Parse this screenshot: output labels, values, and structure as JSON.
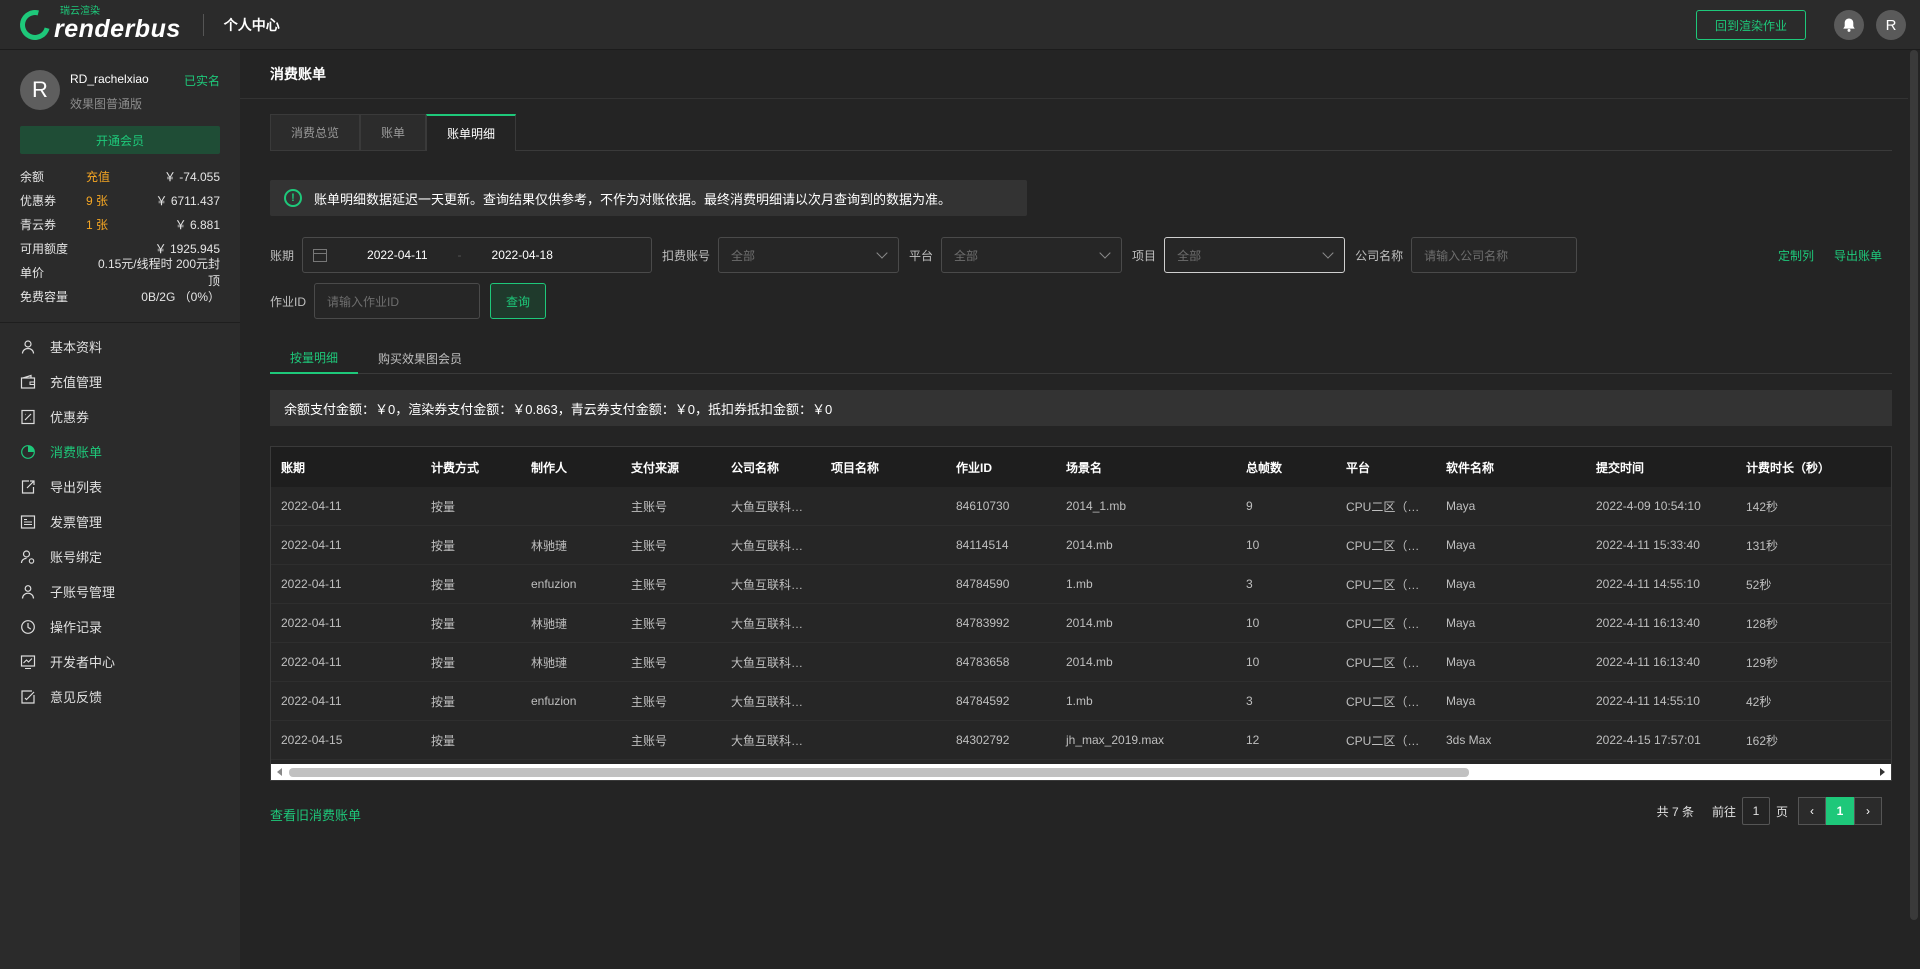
{
  "header": {
    "logo_sub": "瑞云渲染",
    "logo_main": "renderbus",
    "title": "个人中心",
    "back_button": "回到渲染作业",
    "avatar_letter": "R"
  },
  "user": {
    "avatar_letter": "R",
    "name": "RD_rachelxiao",
    "plan": "效果图普通版",
    "verified": "已实名",
    "vip_button": "开通会员",
    "info": [
      {
        "label": "余额",
        "mid": "充值",
        "value": "￥ -74.055"
      },
      {
        "label": "优惠券",
        "mid": "9 张",
        "value": "￥ 6711.437"
      },
      {
        "label": "青云券",
        "mid": "1 张",
        "value": "￥ 6.881"
      },
      {
        "label": "可用额度",
        "mid": "",
        "value": "￥ 1925.945"
      },
      {
        "label": "单价",
        "mid": "",
        "value": "0.15元/线程时 200元封顶"
      },
      {
        "label": "免费容量",
        "mid": "",
        "value": "0B/2G （0%）"
      }
    ]
  },
  "menu": [
    {
      "label": "基本资料",
      "icon": "user-icon"
    },
    {
      "label": "充值管理",
      "icon": "wallet-icon"
    },
    {
      "label": "优惠券",
      "icon": "coupon-icon"
    },
    {
      "label": "消费账单",
      "icon": "bill-icon",
      "active": true
    },
    {
      "label": "导出列表",
      "icon": "export-icon"
    },
    {
      "label": "发票管理",
      "icon": "invoice-icon"
    },
    {
      "label": "账号绑定",
      "icon": "account-bind-icon"
    },
    {
      "label": "子账号管理",
      "icon": "sub-account-icon"
    },
    {
      "label": "操作记录",
      "icon": "clock-icon"
    },
    {
      "label": "开发者中心",
      "icon": "developer-icon"
    },
    {
      "label": "意见反馈",
      "icon": "feedback-icon"
    }
  ],
  "page": {
    "title": "消费账单",
    "tabs": [
      "消费总览",
      "账单",
      "账单明细"
    ],
    "notice": "账单明细数据延迟一天更新。查询结果仅供参考，不作为对账依据。最终消费明细请以次月查询到的数据为准。"
  },
  "filters": {
    "period_label": "账期",
    "date_start": "2022-04-11",
    "date_sep": "-",
    "date_end": "2022-04-18",
    "deduct_label": "扣费账号",
    "deduct_value": "全部",
    "platform_label": "平台",
    "platform_value": "全部",
    "project_label": "项目",
    "project_value": "全部",
    "company_label": "公司名称",
    "company_placeholder": "请输入公司名称",
    "jobid_label": "作业ID",
    "jobid_placeholder": "请输入作业ID",
    "query_button": "查询",
    "custom_columns": "定制列",
    "export_bill": "导出账单"
  },
  "subtabs": [
    "按量明细",
    "购买效果图会员"
  ],
  "summary": "余额支付金额：￥0，渲染券支付金额：￥0.863，青云券支付金额：￥0，抵扣券抵扣金额：￥0",
  "table": {
    "columns": [
      "账期",
      "计费方式",
      "制作人",
      "支付来源",
      "公司名称",
      "项目名称",
      "作业ID",
      "场景名",
      "总帧数",
      "平台",
      "软件名称",
      "提交时间",
      "计费时长（秒）"
    ],
    "rows": [
      [
        "2022-04-11",
        "按量",
        "",
        "主账号",
        "大鱼互联科技有限公司",
        "",
        "84610730",
        "2014_1.mb",
        "9",
        "CPU二区（上海）",
        "Maya",
        "2022-4-09 10:54:10",
        "142秒"
      ],
      [
        "2022-04-11",
        "按量",
        "林驰璉",
        "主账号",
        "大鱼互联科技有限公司",
        "",
        "84114514",
        "2014.mb",
        "10",
        "CPU二区（上海）",
        "Maya",
        "2022-4-11 15:33:40",
        "131秒"
      ],
      [
        "2022-04-11",
        "按量",
        "enfuzion",
        "主账号",
        "大鱼互联科技有限公司",
        "",
        "84784590",
        "1.mb",
        "3",
        "CPU二区（上海）",
        "Maya",
        "2022-4-11 14:55:10",
        "52秒"
      ],
      [
        "2022-04-11",
        "按量",
        "林驰璉",
        "主账号",
        "大鱼互联科技有限公司",
        "",
        "84783992",
        "2014.mb",
        "10",
        "CPU二区（上海）",
        "Maya",
        "2022-4-11 16:13:40",
        "128秒"
      ],
      [
        "2022-04-11",
        "按量",
        "林驰璉",
        "主账号",
        "大鱼互联科技有限公司",
        "",
        "84783658",
        "2014.mb",
        "10",
        "CPU二区（上海）",
        "Maya",
        "2022-4-11 16:13:40",
        "129秒"
      ],
      [
        "2022-04-11",
        "按量",
        "enfuzion",
        "主账号",
        "大鱼互联科技有限公司",
        "",
        "84784592",
        "1.mb",
        "3",
        "CPU二区（上海）",
        "Maya",
        "2022-4-11 14:55:10",
        "42秒"
      ],
      [
        "2022-04-15",
        "按量",
        "",
        "主账号",
        "大鱼互联科技有限公司",
        "",
        "84302792",
        "jh_max_2019.max",
        "12",
        "CPU二区（上海）",
        "3ds Max",
        "2022-4-15 17:57:01",
        "162秒"
      ]
    ]
  },
  "footer": {
    "old_bill_link": "查看旧消费账单",
    "total": "共 7 条",
    "goto": "前往",
    "page_input": "1",
    "page_unit": "页",
    "current_page": "1"
  },
  "colors": {
    "accent": "#1ec87a",
    "warning": "#f5a623"
  }
}
